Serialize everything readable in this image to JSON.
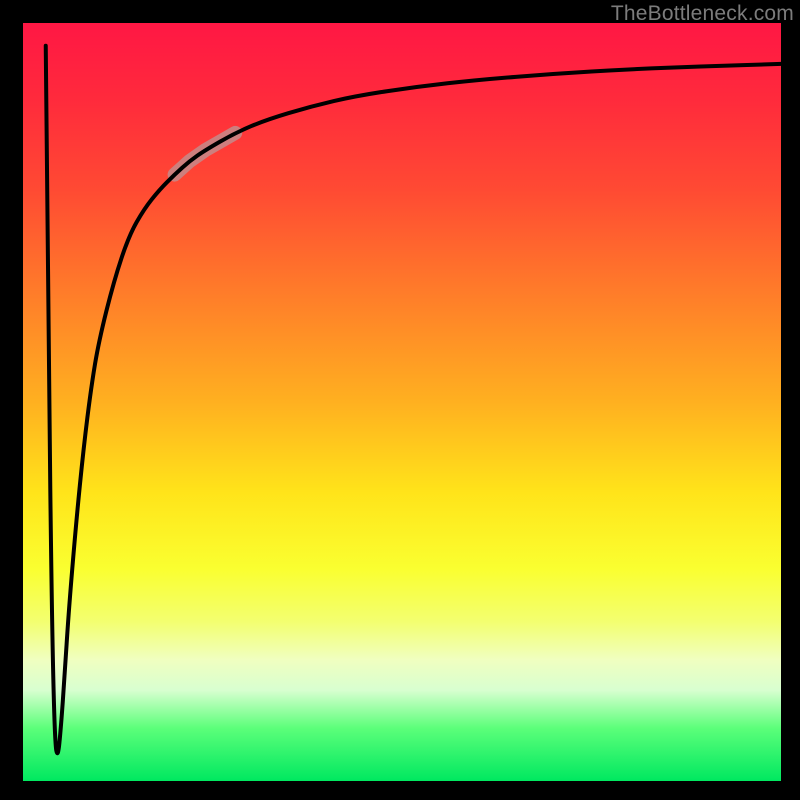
{
  "watermark": "TheBottleneck.com",
  "colors": {
    "page_bg": "#000000",
    "gradient_top": "#ff1744",
    "gradient_mid": "#ffe41a",
    "gradient_bottom": "#00e860",
    "curve": "#000000",
    "highlight": "#c48b8b"
  },
  "chart_data": {
    "type": "line",
    "title": "",
    "xlabel": "",
    "ylabel": "",
    "xlim": [
      0,
      100
    ],
    "ylim": [
      0,
      100
    ],
    "grid": false,
    "legend": false,
    "series": [
      {
        "name": "curve",
        "x": [
          3.0,
          3.4,
          3.8,
          4.2,
          4.6,
          5.0,
          5.5,
          6.0,
          7.0,
          8.0,
          9.0,
          10.0,
          12.0,
          14.0,
          16.0,
          18.0,
          20.0,
          22.0,
          24.0,
          28.0,
          32.0,
          38.0,
          44.0,
          52.0,
          60.0,
          70.0,
          80.0,
          90.0,
          100.0
        ],
        "values": [
          97.0,
          55.0,
          22.0,
          5.0,
          3.0,
          7.0,
          14.0,
          22.0,
          34.0,
          44.0,
          52.0,
          58.0,
          66.0,
          72.0,
          75.5,
          78.0,
          80.0,
          81.8,
          83.2,
          85.5,
          87.2,
          89.0,
          90.4,
          91.6,
          92.5,
          93.3,
          93.9,
          94.3,
          94.6
        ]
      }
    ],
    "highlight_segment": {
      "x_start": 20.0,
      "x_end": 28.0
    }
  }
}
